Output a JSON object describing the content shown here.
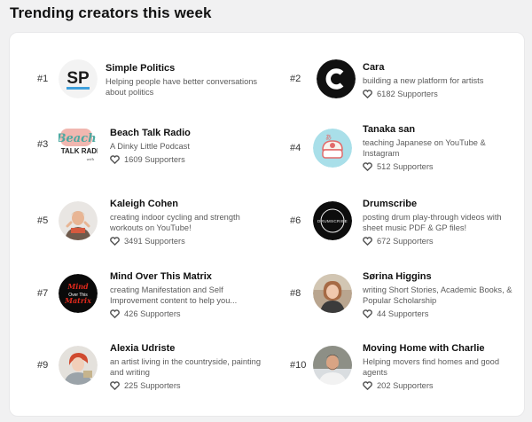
{
  "heading": "Trending creators this week",
  "creators": [
    {
      "rank": "#1",
      "name": "Simple Politics",
      "description": "Helping people have better conversations about politics",
      "supporters": "",
      "avatar_icon": "simple-politics-logo-avatar"
    },
    {
      "rank": "#2",
      "name": "Cara",
      "description": "building a new platform for artists",
      "supporters": "6182 Supporters",
      "avatar_icon": "cara-logo-avatar"
    },
    {
      "rank": "#3",
      "name": "Beach Talk Radio",
      "description": "A Dinky Little Podcast",
      "supporters": "1609 Supporters",
      "avatar_icon": "beach-talk-radio-logo-avatar",
      "avatar_text": "Beach TALK RADI"
    },
    {
      "rank": "#4",
      "name": "Tanaka san",
      "description": "teaching Japanese on YouTube & Instagram",
      "supporters": "512 Supporters",
      "avatar_icon": "tanaka-san-avatar"
    },
    {
      "rank": "#5",
      "name": "Kaleigh Cohen",
      "description": "creating indoor cycling and strength workouts on YouTube!",
      "supporters": "3491 Supporters",
      "avatar_icon": "kaleigh-cohen-photo-avatar"
    },
    {
      "rank": "#6",
      "name": "Drumscribe",
      "description": "posting drum play-through videos with sheet music PDF & GP files!",
      "supporters": "672 Supporters",
      "avatar_icon": "drumscribe-logo-avatar",
      "avatar_text": "DRUMSCRIBE"
    },
    {
      "rank": "#7",
      "name": "Mind Over This Matrix",
      "description": "creating Manifestation and Self Improvement content to help you...",
      "supporters": "426 Supporters",
      "avatar_icon": "mind-over-this-matrix-logo-avatar",
      "avatar_text": "Mind Over This Matrix"
    },
    {
      "rank": "#8",
      "name": "Sørina Higgins",
      "description": "writing Short Stories, Academic Books, & Popular Scholarship",
      "supporters": "44 Supporters",
      "avatar_icon": "sorina-higgins-photo-avatar"
    },
    {
      "rank": "#9",
      "name": "Alexia Udriste",
      "description": "an artist living in the countryside, painting and writing",
      "supporters": "225 Supporters",
      "avatar_icon": "alexia-udriste-photo-avatar"
    },
    {
      "rank": "#10",
      "name": "Moving Home with Charlie",
      "description": "Helping movers find homes and good agents",
      "supporters": "202 Supporters",
      "avatar_icon": "moving-home-charlie-photo-avatar"
    }
  ],
  "colors": {
    "page_bg": "#f1f1f2",
    "card_bg": "#ffffff",
    "heart_stroke": "#555555",
    "politics_blue": "#3fa0dc"
  }
}
